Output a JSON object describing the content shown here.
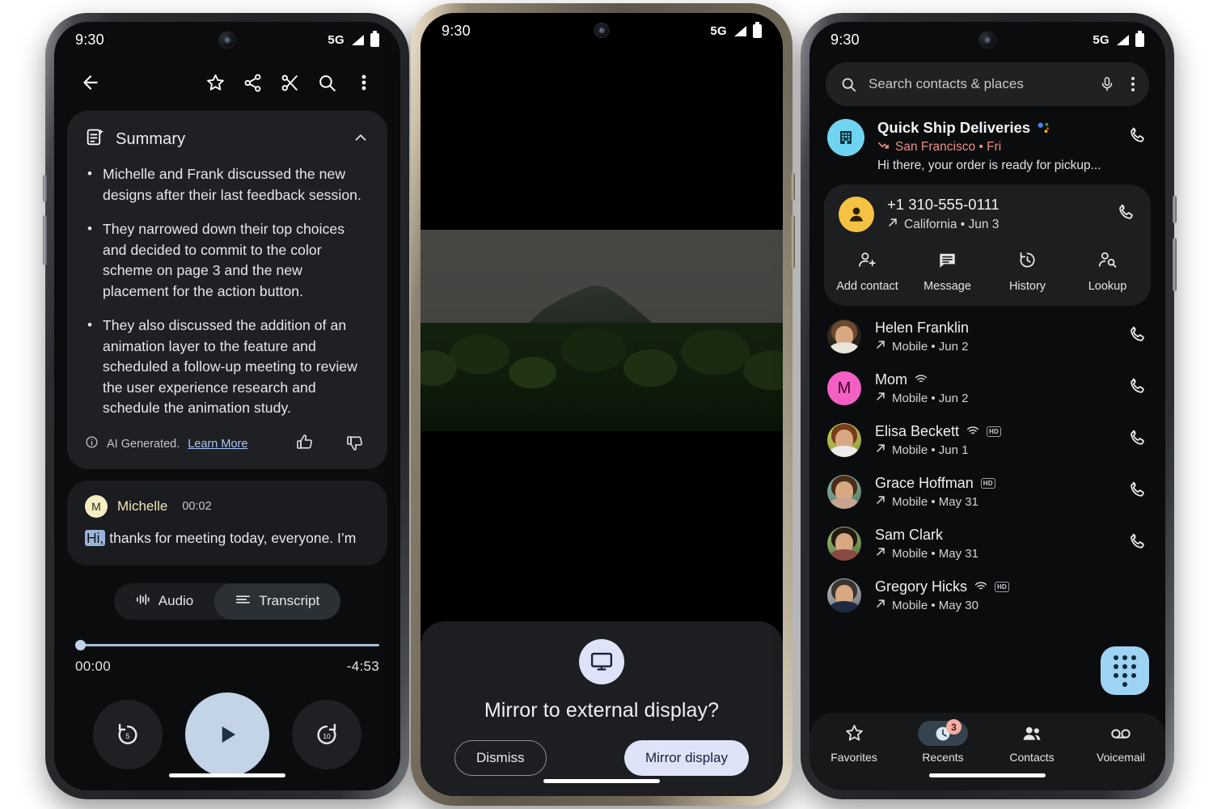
{
  "phone1": {
    "status": {
      "time": "9:30",
      "network": "5G"
    },
    "toolbar": {
      "back": "back-arrow",
      "items": [
        "star-icon",
        "share-icon",
        "scissors-icon",
        "search-icon",
        "overflow-menu-icon"
      ]
    },
    "summary_card": {
      "icon": "summarize-sparkle-icon",
      "title": "Summary",
      "collapse": "chevron-up-icon",
      "bullets": [
        "Michelle and Frank discussed the new designs after their last feedback session.",
        "They narrowed down their top choices and decided to commit to the color scheme on page 3 and the new placement for the action button.",
        "They also discussed the addition of an animation layer to the feature and scheduled a follow-up meeting to review the user experience research and schedule the animation study."
      ],
      "footer_note": "AI Generated.",
      "footer_link": "Learn More",
      "thumbs_up": "thumb-up-icon",
      "thumbs_down": "thumb-down-icon"
    },
    "transcript_card": {
      "avatar_letter": "M",
      "speaker": "Michelle",
      "timestamp": "00:02",
      "highlight": "Hi,",
      "line": " thanks for meeting today, everyone. I’m"
    },
    "tabs": [
      {
        "label": "Audio",
        "icon": "waveform-icon",
        "active": false
      },
      {
        "label": "Transcript",
        "icon": "transcript-lines-icon",
        "active": true
      }
    ],
    "player": {
      "elapsed": "00:00",
      "remaining": "-4:53",
      "progress_percent": 0,
      "rewind_label": "5",
      "forward_label": "10",
      "play_icon": "play-icon"
    }
  },
  "phone2": {
    "status": {
      "time": "9:30",
      "network": "5G"
    },
    "photo": {
      "description": "volcano-and-jungle-photo"
    },
    "dialog": {
      "icon": "external-display-icon",
      "title": "Mirror to external display?",
      "dismiss_label": "Dismiss",
      "confirm_label": "Mirror display"
    }
  },
  "phone3": {
    "status": {
      "time": "9:30",
      "network": "5G"
    },
    "search": {
      "placeholder": "Search contacts & places",
      "search_icon": "search-icon",
      "mic_icon": "microphone-icon",
      "overflow_icon": "overflow-menu-icon"
    },
    "business": {
      "icon": "business-building-icon",
      "name": "Quick Ship Deliveries",
      "verified_icon": "google-assistant-dots",
      "call_type_icon": "missed-call-icon",
      "location_date": "San Francisco • Fri",
      "message": "Hi there, your order is ready for pickup..."
    },
    "unknown_number": {
      "avatar_icon": "person-icon",
      "number": "+1 310-555-0111",
      "call_type_icon": "outgoing-call-icon",
      "location_date": "California • Jun 3"
    },
    "quick_actions": [
      {
        "label": "Add contact",
        "icon": "person-add-icon"
      },
      {
        "label": "Message",
        "icon": "message-icon"
      },
      {
        "label": "History",
        "icon": "history-icon"
      },
      {
        "label": "Lookup",
        "icon": "person-search-icon"
      }
    ],
    "call_log": [
      {
        "name": "Helen Franklin",
        "detail": "Mobile • Jun 2",
        "wifi": false,
        "hd": false,
        "avatar": "photo-helen"
      },
      {
        "name": "Mom",
        "detail": "Mobile • Jun 2",
        "wifi": true,
        "hd": false,
        "avatar": "initial-m"
      },
      {
        "name": "Elisa Beckett",
        "detail": "Mobile • Jun 1",
        "wifi": true,
        "hd": true,
        "avatar": "photo-elisa"
      },
      {
        "name": "Grace Hoffman",
        "detail": "Mobile • May 31",
        "wifi": false,
        "hd": true,
        "avatar": "photo-grace"
      },
      {
        "name": "Sam Clark",
        "detail": "Mobile • May 31",
        "wifi": false,
        "hd": false,
        "avatar": "photo-sam"
      },
      {
        "name": "Gregory Hicks",
        "detail": "Mobile • May 30",
        "wifi": true,
        "hd": true,
        "avatar": "photo-gregory"
      }
    ],
    "fab": {
      "icon": "dialpad-icon"
    },
    "nav": [
      {
        "label": "Favorites",
        "icon": "star-icon",
        "active": false,
        "badge": ""
      },
      {
        "label": "Recents",
        "icon": "recents-clock-icon",
        "active": true,
        "badge": "3"
      },
      {
        "label": "Contacts",
        "icon": "contacts-people-icon",
        "active": false,
        "badge": ""
      },
      {
        "label": "Voicemail",
        "icon": "voicemail-icon",
        "active": false,
        "badge": ""
      }
    ]
  },
  "colors": {
    "accent_blue": "#a8c7fa",
    "play_button": "#c2d4e6",
    "fab_blue": "#9fd3f3",
    "business_avatar": "#6ed4ef",
    "unknown_avatar": "#f6c244",
    "mom_avatar": "#f45fc4",
    "missed_call_red": "#ef8e83",
    "badge_bg": "#f4b0a6",
    "dialog_fill": "#dfe3f7"
  }
}
